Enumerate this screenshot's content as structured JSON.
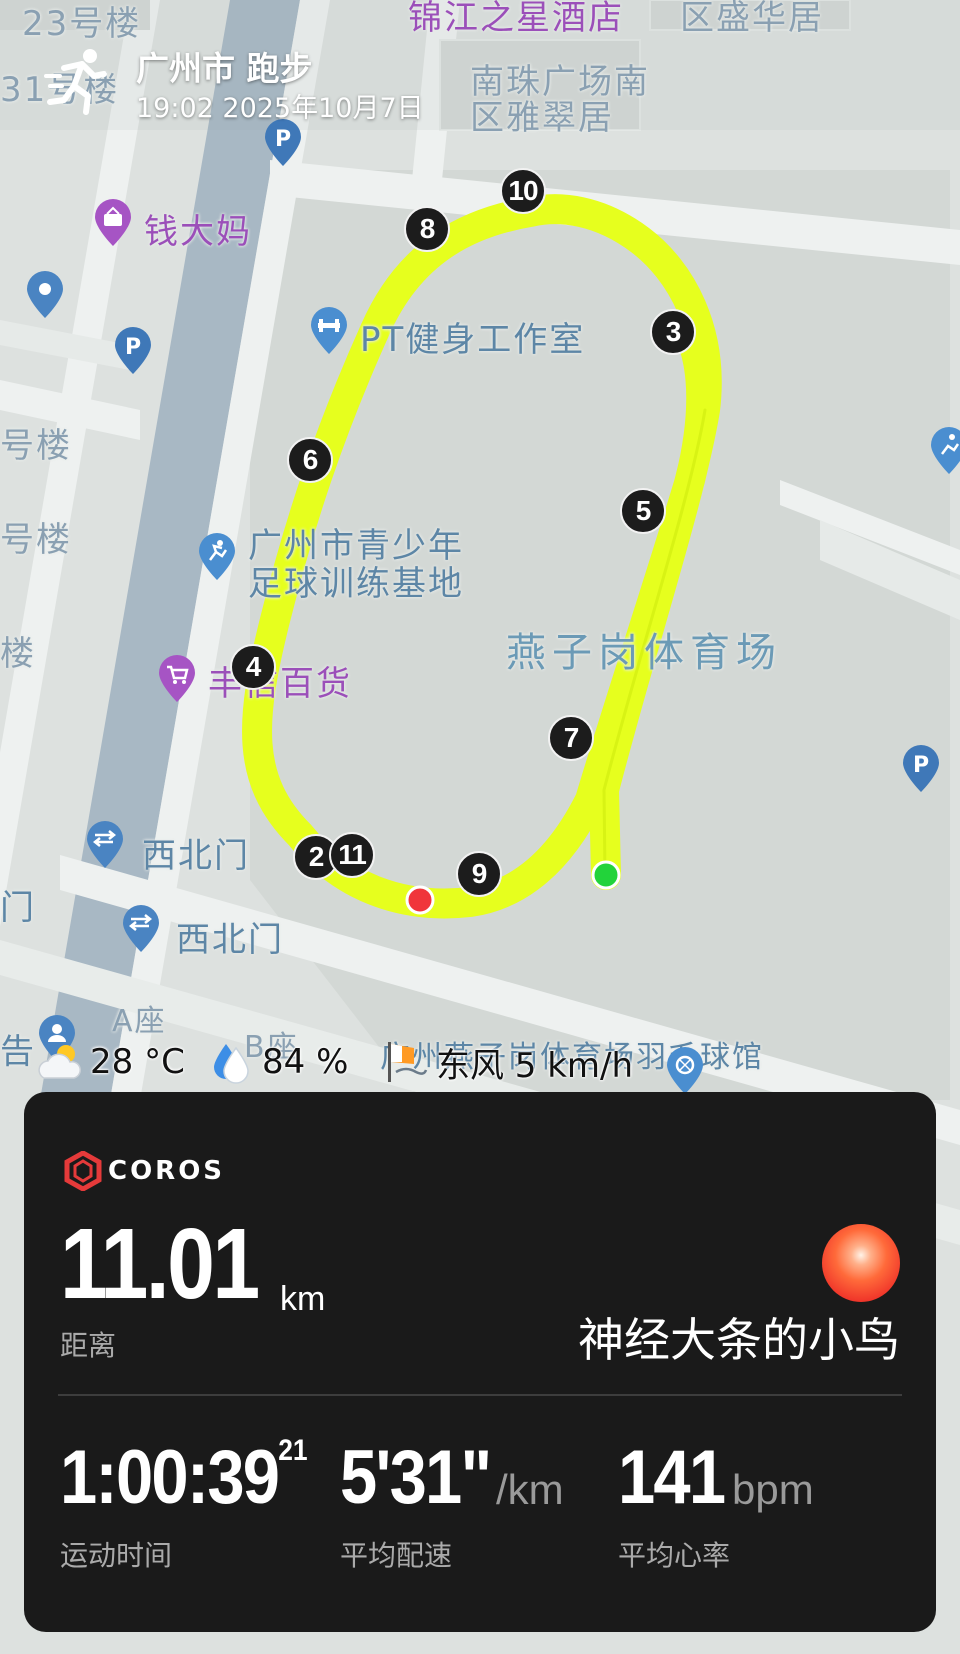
{
  "header": {
    "title": "广州市 跑步",
    "datetime": "19:02 2025年10月7日"
  },
  "map": {
    "labels": {
      "building_23": "23号楼",
      "hotel": "锦江之星酒店",
      "residence_top": "区盛华居",
      "building_31": "31号楼",
      "nanzhu_1": "南珠广场南",
      "nanzhu_2": "区雅翠居",
      "qiandama": "钱大妈",
      "gym": "PT健身工作室",
      "lou_1": "号楼",
      "lou_2": "号楼",
      "lou_3": "楼",
      "youth_1": "广州市青少年",
      "youth_2": "足球训练基地",
      "stadium": "燕子岗体育场",
      "fengxin": "丰信百货",
      "xibeimen_1": "西北门",
      "xibeimen_2": "西北门",
      "men_left": "门",
      "azuo": "A座",
      "bzuo": "B座",
      "gao_left": "告",
      "badminton": "广州燕子岗体育场羽毛球馆"
    },
    "km_markers": [
      "10",
      "8",
      "3",
      "6",
      "5",
      "4",
      "7",
      "2",
      "11",
      "9"
    ],
    "route_color": "#e6ff1e",
    "start_color": "#22d33a",
    "end_color": "#f0353b"
  },
  "weather": {
    "temperature": "28 °C",
    "humidity": "84 %",
    "wind": "东风 5 km/h"
  },
  "card": {
    "brand": "COROS",
    "distance_value": "11.01",
    "distance_unit": "km",
    "distance_label": "距离",
    "username": "神经大条的小鸟",
    "time_value": "1:00:39",
    "time_sup": "21",
    "time_label": "运动时间",
    "pace_value": "5'31\"",
    "pace_unit": "/km",
    "pace_label": "平均配速",
    "hr_value": "141",
    "hr_unit": "bpm",
    "hr_label": "平均心率"
  }
}
